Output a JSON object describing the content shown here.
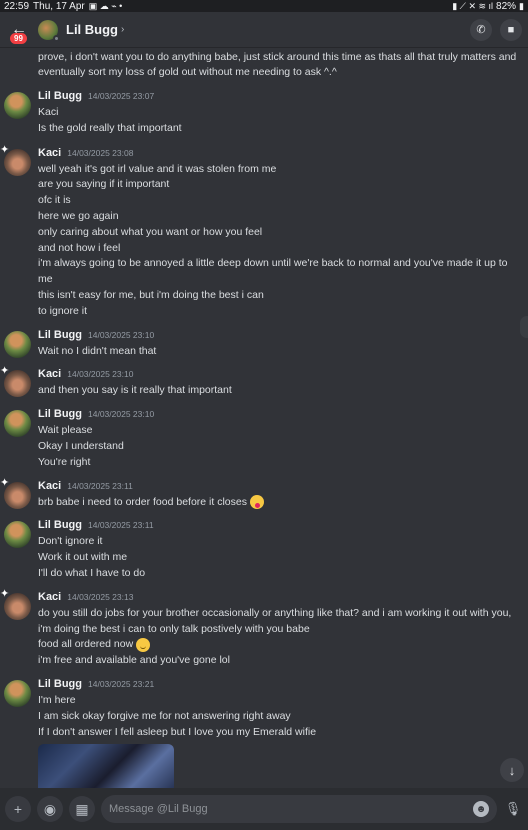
{
  "status_bar": {
    "time": "22:59",
    "date": "Thu, 17 Apr",
    "battery": "82%"
  },
  "header": {
    "title": "Lil Bugg",
    "badge": "99"
  },
  "top_text": "prove, i don't want you to do anything babe, just stick around this time as thats all that truly matters and eventually sort my loss of gold out without me needing to ask ^.^",
  "groups": [
    {
      "author": "Lil Bugg",
      "timestamp": "14/03/2025 23:07",
      "lines": [
        "Kaci",
        "Is the gold really that important"
      ]
    },
    {
      "author": "Kaci",
      "timestamp": "14/03/2025 23:08",
      "lines": [
        "well yeah it's got irl value and it was stolen from me",
        "are you saying if it important",
        "ofc it is",
        "here we go again",
        "only caring about what you want or how you feel",
        "and not how i feel",
        "i'm always going to be annoyed a little deep down until we're back to normal and you've made it up to me",
        "this isn't easy for me, but i'm doing the best i can",
        "to ignore it"
      ]
    },
    {
      "author": "Lil Bugg",
      "timestamp": "14/03/2025 23:10",
      "lines": [
        "Wait no I didn't mean that"
      ]
    },
    {
      "author": "Kaci",
      "timestamp": "14/03/2025 23:10",
      "lines": [
        "and then you say is it really that important"
      ]
    },
    {
      "author": "Lil Bugg",
      "timestamp": "14/03/2025 23:10",
      "lines": [
        "Wait please",
        "Okay I understand",
        "You're right"
      ]
    },
    {
      "author": "Kaci",
      "timestamp": "14/03/2025 23:11",
      "lines": [
        "brb babe i need to order food before it closes"
      ]
    },
    {
      "author": "Lil Bugg",
      "timestamp": "14/03/2025 23:11",
      "lines": [
        "Don't ignore it",
        "Work it out with me",
        "I'll do what I have to do"
      ]
    },
    {
      "author": "Kaci",
      "timestamp": "14/03/2025 23:13",
      "lines": [
        "do you still do jobs for your brother occasionally or anything like that? and i am working it out with you, i'm doing the best i can to only talk postively with you babe",
        "food all ordered now",
        "i'm free and available and you've gone lol"
      ]
    },
    {
      "author": "Lil Bugg",
      "timestamp": "14/03/2025 23:21",
      "lines": [
        "I'm here",
        "I am sick okay forgive me for not answering right away",
        "If I don't answer I fell asleep but I love you my Emerald wifie"
      ]
    }
  ],
  "composer": {
    "placeholder": "Message @Lil Bugg"
  }
}
